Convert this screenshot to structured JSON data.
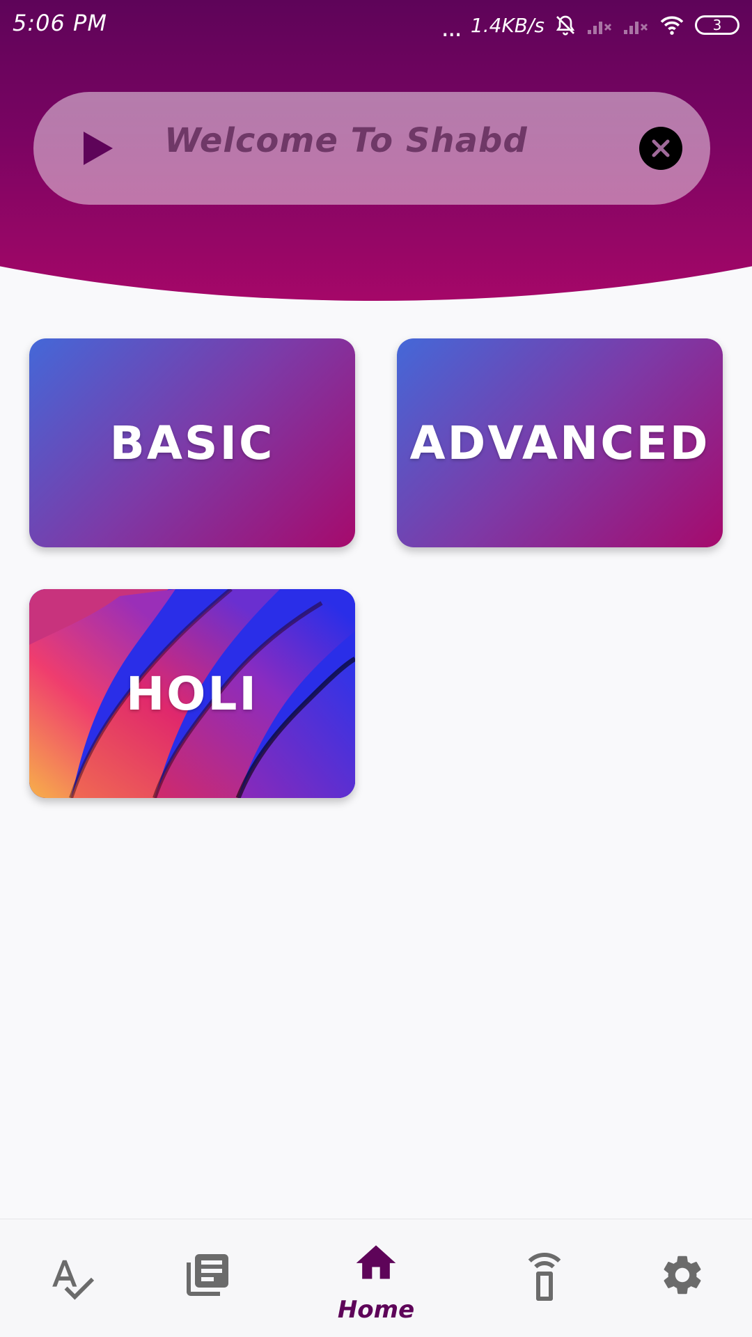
{
  "status_bar": {
    "time": "5:06 PM",
    "dots": "...",
    "net_speed": "1.4KB/s",
    "battery": "3",
    "icons": [
      "bell-off-icon",
      "signal-icon",
      "signal-icon",
      "wifi-icon",
      "battery-icon"
    ]
  },
  "banner": {
    "text": "Welcome To Shabd",
    "play_icon": "play-icon",
    "close_icon": "close-icon"
  },
  "cards": [
    {
      "label": "BASIC"
    },
    {
      "label": "ADVANCED"
    },
    {
      "label": "HOLI"
    }
  ],
  "bottom_nav": {
    "items": [
      {
        "icon": "spellcheck-icon"
      },
      {
        "icon": "library-books-icon"
      },
      {
        "icon": "home-icon",
        "label": "Home",
        "active": true
      },
      {
        "icon": "remote-device-icon"
      },
      {
        "icon": "settings-gear-icon"
      }
    ]
  },
  "colors": {
    "primary": "#5e0459",
    "header_bottom": "#a50768",
    "card_start": "#4468d8",
    "card_end": "#a60a6c",
    "icon_inactive": "#6b6b6b"
  }
}
